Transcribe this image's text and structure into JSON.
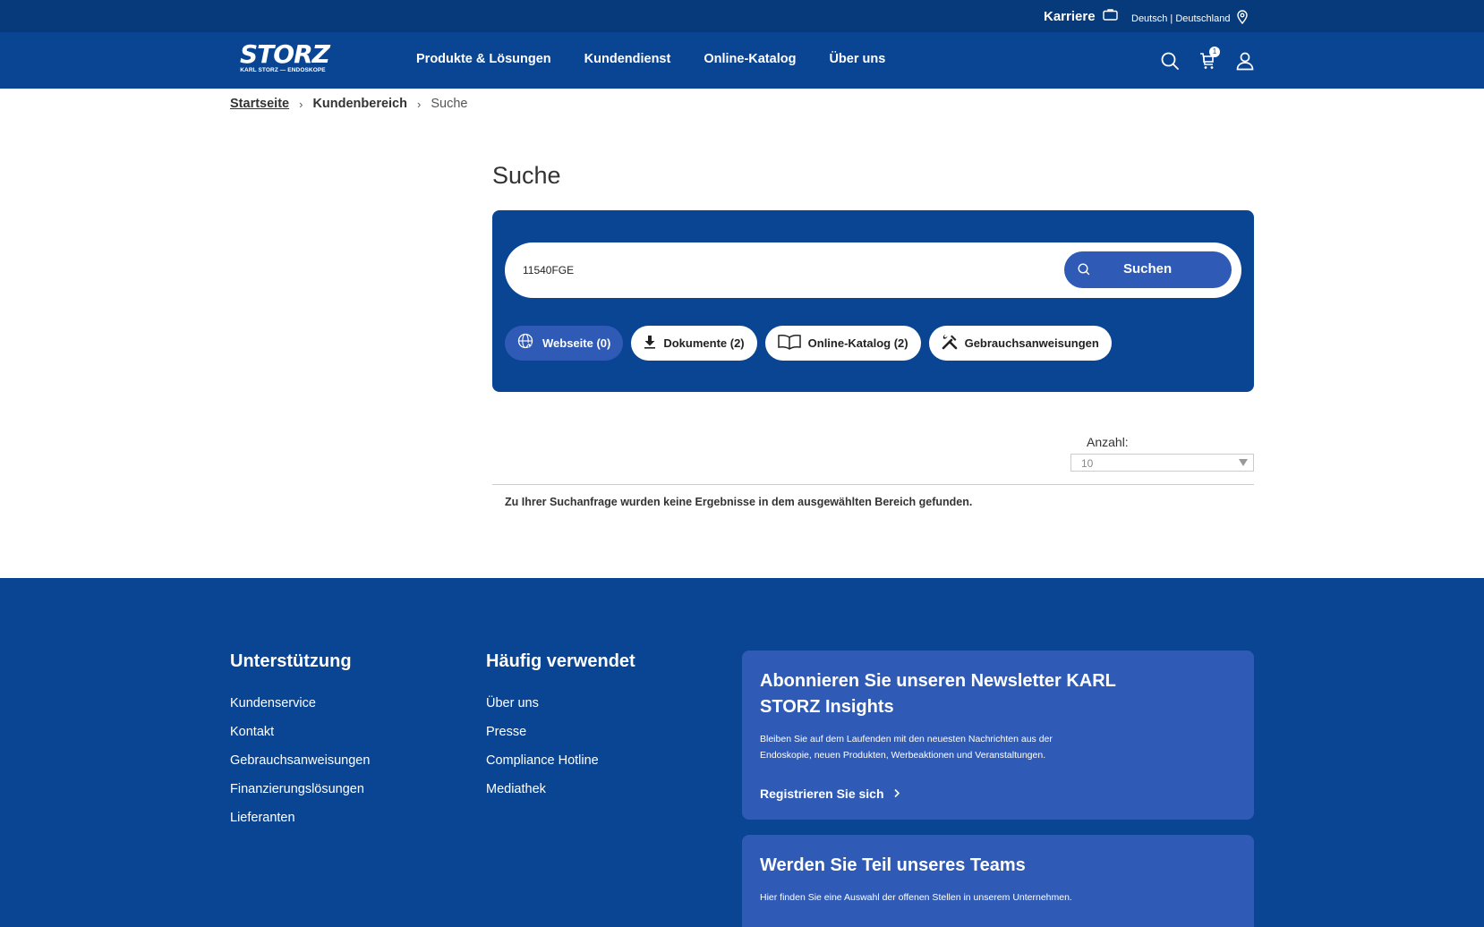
{
  "topbar": {
    "career_label": "Karriere",
    "language_label": "Deutsch | Deutschland"
  },
  "nav": {
    "logo_word": "STORZ",
    "logo_sub": "KARL STORZ — ENDOSKOPE",
    "links": [
      "Produkte & Lösungen",
      "Kundendienst",
      "Online-Katalog",
      "Über uns"
    ],
    "cart_count": "1"
  },
  "breadcrumb": {
    "home": "Startseite",
    "section": "Kundenbereich",
    "current": "Suche",
    "separator": "›"
  },
  "page": {
    "title": "Suche"
  },
  "search": {
    "value": "11540FGE",
    "button_label": "Suchen",
    "chips": [
      {
        "label": "Webseite (0)",
        "icon": "globe-cursor-icon",
        "active": true
      },
      {
        "label": "Dokumente (2)",
        "icon": "download-icon",
        "active": false
      },
      {
        "label": "Online-Katalog (2)",
        "icon": "book-icon",
        "active": false
      },
      {
        "label": "Gebrauchsanweisungen",
        "icon": "tools-icon",
        "active": false
      }
    ]
  },
  "results": {
    "count_label": "Anzahl:",
    "count_value": "10",
    "empty_message": "Zu Ihrer Suchanfrage wurden keine Ergebnisse in dem ausgewählten Bereich gefunden."
  },
  "footer": {
    "support_title": "Unterstützung",
    "support_links": [
      "Kundenservice",
      "Kontakt",
      "Gebrauchsanweisungen",
      "Finanzierungslösungen",
      "Lieferanten"
    ],
    "frequent_title": "Häufig verwendet",
    "frequent_links": [
      "Über uns",
      "Presse",
      "Compliance Hotline",
      "Mediathek"
    ],
    "newsletter": {
      "title": "Abonnieren Sie unseren Newsletter KARL STORZ Insights",
      "text": "Bleiben Sie auf dem Laufenden mit den neuesten Nachrichten aus der Endoskopie, neuen Produkten, Werbeaktionen und Veranstaltungen.",
      "cta": "Registrieren Sie sich"
    },
    "careers": {
      "title": "Werden Sie Teil unseres Teams",
      "text": "Hier finden Sie eine Auswahl der offenen Stellen in unserem Unternehmen."
    }
  },
  "colors": {
    "topbar": "#073a7a",
    "brand_blue": "#0a4594",
    "accent_blue": "#2f5bb7"
  }
}
